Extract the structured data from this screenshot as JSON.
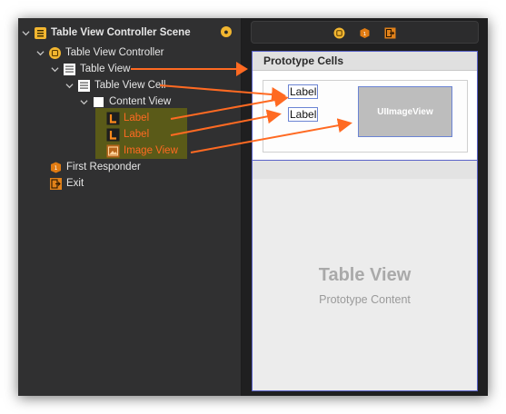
{
  "outline": {
    "scene_title": "Table View Controller Scene",
    "items": [
      {
        "label": "Table View Controller",
        "icon": "view-controller-icon"
      },
      {
        "label": "Table View",
        "icon": "table-view-icon"
      },
      {
        "label": "Table View Cell",
        "icon": "table-cell-icon"
      },
      {
        "label": "Content View",
        "icon": "content-view-icon"
      },
      {
        "label": "Label",
        "icon": "label-icon"
      },
      {
        "label": "Label",
        "icon": "label-icon"
      },
      {
        "label": "Image View",
        "icon": "image-view-icon"
      },
      {
        "label": "First Responder",
        "icon": "first-responder-icon"
      },
      {
        "label": "Exit",
        "icon": "exit-icon"
      }
    ],
    "highlight_color": "#5a5a18",
    "connection_color": "#ff6a22"
  },
  "scene_bar": {
    "icons": [
      "view-controller-icon",
      "first-responder-icon",
      "exit-icon"
    ]
  },
  "canvas": {
    "prototype_header": "Prototype Cells",
    "cell_label_1": "Label",
    "cell_label_2": "Label",
    "image_view_text": "UIImageView",
    "placeholder_title": "Table View",
    "placeholder_subtitle": "Prototype Content",
    "selection_color": "#5a63c9"
  }
}
